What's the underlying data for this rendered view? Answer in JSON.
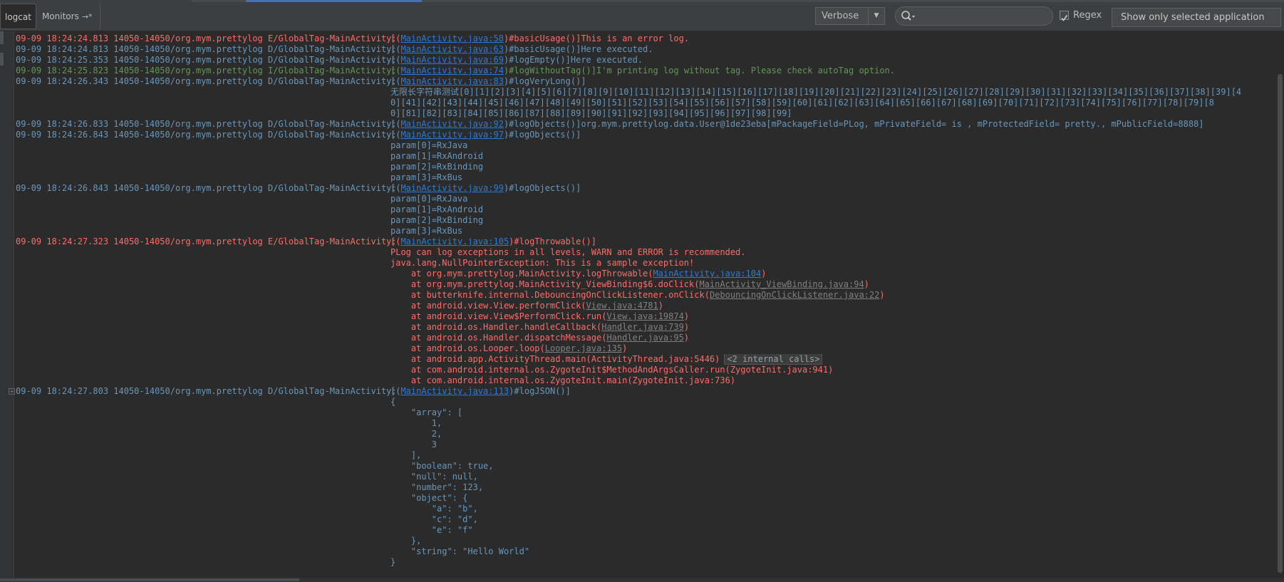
{
  "toolbar": {
    "tabs": [
      {
        "label": "logcat",
        "suffix": ""
      },
      {
        "label": "Monitors",
        "suffix": "→*"
      }
    ],
    "log_level": "Verbose",
    "search": {
      "value": "",
      "placeholder": ""
    },
    "regex_label": "Regex",
    "regex_checked": true,
    "app_filter": "Show only selected application"
  },
  "colors": {
    "error": "#ff6b68",
    "debug": "#6897bb",
    "info": "#629755",
    "link": "#287bde",
    "background": "#2b2b2b"
  },
  "lines": [
    {
      "level": "E",
      "meta": "09-09 18:24:24.813 14050-14050/org.mym.prettylog E/GlobalTag-MainActivity:",
      "segs": [
        {
          "t": "[("
        },
        {
          "t": "MainActivity.java:58",
          "s": "link"
        },
        {
          "t": ")#basicUsage()]This is an error log."
        }
      ]
    },
    {
      "level": "D",
      "meta": "09-09 18:24:24.813 14050-14050/org.mym.prettylog D/GlobalTag-MainActivity:",
      "segs": [
        {
          "t": "[("
        },
        {
          "t": "MainActivity.java:63",
          "s": "link"
        },
        {
          "t": ")#basicUsage()]Here executed."
        }
      ]
    },
    {
      "level": "D",
      "meta": "09-09 18:24:25.353 14050-14050/org.mym.prettylog D/GlobalTag-MainActivity:",
      "segs": [
        {
          "t": "[("
        },
        {
          "t": "MainActivity.java:69",
          "s": "link"
        },
        {
          "t": ")#logEmpty()]Here executed."
        }
      ]
    },
    {
      "level": "I",
      "meta": "09-09 18:24:25.823 14050-14050/org.mym.prettylog I/GlobalTag-MainActivity:",
      "segs": [
        {
          "t": "[("
        },
        {
          "t": "MainActivity.java:74",
          "s": "link"
        },
        {
          "t": ")#logWithoutTag()]I'm printing log without tag. Please check autoTag option."
        }
      ]
    },
    {
      "level": "D",
      "meta": "09-09 18:24:26.343 14050-14050/org.mym.prettylog D/GlobalTag-MainActivity:",
      "segs": [
        {
          "t": "[("
        },
        {
          "t": "MainActivity.java:83",
          "s": "link"
        },
        {
          "t": ")#logVeryLong()]"
        }
      ]
    },
    {
      "level": "D",
      "meta": "",
      "segs": [
        {
          "t": "无限长字符串测试[0][1][2][3][4][5][6][7][8][9][10][11][12][13][14][15][16][17][18][19][20][21][22][23][24][25][26][27][28][29][30][31][32][33][34][35][36][37][38][39][4"
        }
      ]
    },
    {
      "level": "D",
      "meta": "",
      "segs": [
        {
          "t": "0][41][42][43][44][45][46][47][48][49][50][51][52][53][54][55][56][57][58][59][60][61][62][63][64][65][66][67][68][69][70][71][72][73][74][75][76][77][78][79][8"
        }
      ]
    },
    {
      "level": "D",
      "meta": "",
      "segs": [
        {
          "t": "0][81][82][83][84][85][86][87][88][89][90][91][92][93][94][95][96][97][98][99]"
        }
      ]
    },
    {
      "level": "D",
      "meta": "09-09 18:24:26.833 14050-14050/org.mym.prettylog D/GlobalTag-MainActivity:",
      "segs": [
        {
          "t": "[("
        },
        {
          "t": "MainActivity.java:92",
          "s": "link"
        },
        {
          "t": ")#logObjects()]org.mym.prettylog.data.User@1de23eba[mPackageField=PLog, mPrivateField= is , mProtectedField= pretty., mPublicField=8888]"
        }
      ]
    },
    {
      "level": "D",
      "meta": "09-09 18:24:26.843 14050-14050/org.mym.prettylog D/GlobalTag-MainActivity:",
      "segs": [
        {
          "t": "[("
        },
        {
          "t": "MainActivity.java:97",
          "s": "link"
        },
        {
          "t": ")#logObjects()]"
        }
      ]
    },
    {
      "level": "D",
      "meta": "",
      "segs": [
        {
          "t": "param[0]=RxJava"
        }
      ]
    },
    {
      "level": "D",
      "meta": "",
      "segs": [
        {
          "t": "param[1]=RxAndroid"
        }
      ]
    },
    {
      "level": "D",
      "meta": "",
      "segs": [
        {
          "t": "param[2]=RxBinding"
        }
      ]
    },
    {
      "level": "D",
      "meta": "",
      "segs": [
        {
          "t": "param[3]=RxBus"
        }
      ]
    },
    {
      "level": "D",
      "meta": "09-09 18:24:26.843 14050-14050/org.mym.prettylog D/GlobalTag-MainActivity:",
      "segs": [
        {
          "t": "[("
        },
        {
          "t": "MainActivity.java:99",
          "s": "link"
        },
        {
          "t": ")#logObjects()]"
        }
      ]
    },
    {
      "level": "D",
      "meta": "",
      "segs": [
        {
          "t": "param[0]=RxJava"
        }
      ]
    },
    {
      "level": "D",
      "meta": "",
      "segs": [
        {
          "t": "param[1]=RxAndroid"
        }
      ]
    },
    {
      "level": "D",
      "meta": "",
      "segs": [
        {
          "t": "param[2]=RxBinding"
        }
      ]
    },
    {
      "level": "D",
      "meta": "",
      "segs": [
        {
          "t": "param[3]=RxBus"
        }
      ]
    },
    {
      "level": "E",
      "meta": "09-09 18:24:27.323 14050-14050/org.mym.prettylog E/GlobalTag-MainActivity:",
      "segs": [
        {
          "t": "[("
        },
        {
          "t": "MainActivity.java:105",
          "s": "link"
        },
        {
          "t": ")#logThrowable()]"
        }
      ]
    },
    {
      "level": "E",
      "meta": "",
      "segs": [
        {
          "t": "PLog can log exceptions in all levels, WARN and ERROR is recommended."
        }
      ]
    },
    {
      "level": "E",
      "meta": "",
      "segs": [
        {
          "t": "java.lang.NullPointerException: This is a sample exception!"
        }
      ]
    },
    {
      "level": "E",
      "meta": "",
      "segs": [
        {
          "t": "    at org.mym.prettylog.MainActivity.logThrowable("
        },
        {
          "t": "MainActivity.java:104",
          "s": "link"
        },
        {
          "t": ")"
        }
      ]
    },
    {
      "level": "E",
      "meta": "",
      "segs": [
        {
          "t": "    at org.mym.prettylog.MainActivity_ViewBinding$6.doClick("
        },
        {
          "t": "MainActivity_ViewBinding.java:94",
          "s": "muted"
        },
        {
          "t": ")"
        }
      ]
    },
    {
      "level": "E",
      "meta": "",
      "segs": [
        {
          "t": "    at butterknife.internal.DebouncingOnClickListener.onClick("
        },
        {
          "t": "DebouncingOnClickListener.java:22",
          "s": "muted"
        },
        {
          "t": ")"
        }
      ]
    },
    {
      "level": "E",
      "meta": "",
      "segs": [
        {
          "t": "    at android.view.View.performClick("
        },
        {
          "t": "View.java:4781",
          "s": "muted"
        },
        {
          "t": ")"
        }
      ]
    },
    {
      "level": "E",
      "meta": "",
      "segs": [
        {
          "t": "    at android.view.View$PerformClick.run("
        },
        {
          "t": "View.java:19874",
          "s": "muted"
        },
        {
          "t": ")"
        }
      ]
    },
    {
      "level": "E",
      "meta": "",
      "segs": [
        {
          "t": "    at android.os.Handler.handleCallback("
        },
        {
          "t": "Handler.java:739",
          "s": "muted"
        },
        {
          "t": ")"
        }
      ]
    },
    {
      "level": "E",
      "meta": "",
      "segs": [
        {
          "t": "    at android.os.Handler.dispatchMessage("
        },
        {
          "t": "Handler.java:95",
          "s": "muted"
        },
        {
          "t": ")"
        }
      ]
    },
    {
      "level": "E",
      "meta": "",
      "segs": [
        {
          "t": "    at android.os.Looper.loop("
        },
        {
          "t": "Looper.java:135",
          "s": "muted"
        },
        {
          "t": ")"
        }
      ]
    },
    {
      "level": "E",
      "meta": "",
      "segs": [
        {
          "t": "    at android.app.ActivityThread.main(ActivityThread.java:5446)"
        },
        {
          "t": "<2 internal calls>",
          "s": "fold"
        }
      ]
    },
    {
      "level": "E",
      "meta": "",
      "segs": [
        {
          "t": "    at com.android.internal.os.ZygoteInit$MethodAndArgsCaller.run(ZygoteInit.java:941)"
        }
      ]
    },
    {
      "level": "E",
      "meta": "",
      "segs": [
        {
          "t": "    at com.android.internal.os.ZygoteInit.main(ZygoteInit.java:736)"
        }
      ]
    },
    {
      "level": "D",
      "meta": "09-09 18:24:27.803 14050-14050/org.mym.prettylog D/GlobalTag-MainActivity:",
      "segs": [
        {
          "t": "[("
        },
        {
          "t": "MainActivity.java:113",
          "s": "link"
        },
        {
          "t": ")#logJSON()]"
        }
      ]
    },
    {
      "level": "D",
      "meta": "",
      "segs": [
        {
          "t": "{"
        }
      ]
    },
    {
      "level": "D",
      "meta": "",
      "segs": [
        {
          "t": "    \"array\": ["
        }
      ]
    },
    {
      "level": "D",
      "meta": "",
      "segs": [
        {
          "t": "        1,"
        }
      ]
    },
    {
      "level": "D",
      "meta": "",
      "segs": [
        {
          "t": "        2,"
        }
      ]
    },
    {
      "level": "D",
      "meta": "",
      "segs": [
        {
          "t": "        3"
        }
      ]
    },
    {
      "level": "D",
      "meta": "",
      "segs": [
        {
          "t": "    ],"
        }
      ]
    },
    {
      "level": "D",
      "meta": "",
      "segs": [
        {
          "t": "    \"boolean\": true,"
        }
      ]
    },
    {
      "level": "D",
      "meta": "",
      "segs": [
        {
          "t": "    \"null\": null,"
        }
      ]
    },
    {
      "level": "D",
      "meta": "",
      "segs": [
        {
          "t": "    \"number\": 123,"
        }
      ]
    },
    {
      "level": "D",
      "meta": "",
      "segs": [
        {
          "t": "    \"object\": {"
        }
      ]
    },
    {
      "level": "D",
      "meta": "",
      "segs": [
        {
          "t": "        \"a\": \"b\","
        }
      ]
    },
    {
      "level": "D",
      "meta": "",
      "segs": [
        {
          "t": "        \"c\": \"d\","
        }
      ]
    },
    {
      "level": "D",
      "meta": "",
      "segs": [
        {
          "t": "        \"e\": \"f\""
        }
      ]
    },
    {
      "level": "D",
      "meta": "",
      "segs": [
        {
          "t": "    },"
        }
      ]
    },
    {
      "level": "D",
      "meta": "",
      "segs": [
        {
          "t": "    \"string\": \"Hello World\""
        }
      ]
    },
    {
      "level": "D",
      "meta": "",
      "segs": [
        {
          "t": "}"
        }
      ]
    }
  ]
}
